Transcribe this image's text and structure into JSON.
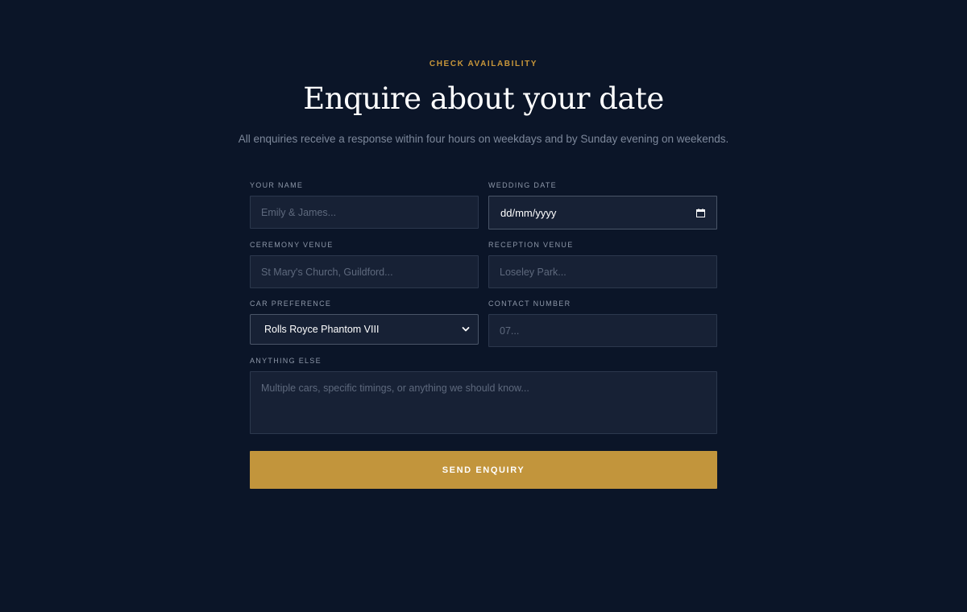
{
  "header": {
    "eyebrow": "CHECK AVAILABILITY",
    "title": "Enquire about your date",
    "subtitle": "All enquiries receive a response within four hours on weekdays and by Sunday evening on weekends."
  },
  "form": {
    "name": {
      "label": "YOUR NAME",
      "placeholder": "Emily & James...",
      "value": ""
    },
    "wedding_date": {
      "label": "WEDDING DATE",
      "value": "dd/mm/yyyy",
      "icon": "calendar-icon"
    },
    "ceremony_venue": {
      "label": "CEREMONY VENUE",
      "placeholder": "St Mary's Church, Guildford...",
      "value": ""
    },
    "reception_venue": {
      "label": "RECEPTION VENUE",
      "placeholder": "Loseley Park...",
      "value": ""
    },
    "car_preference": {
      "label": "CAR PREFERENCE",
      "selected": "Rolls Royce Phantom VIII",
      "icon": "chevron-down-icon"
    },
    "contact_number": {
      "label": "CONTACT NUMBER",
      "placeholder": "07...",
      "value": ""
    },
    "anything_else": {
      "label": "ANYTHING ELSE",
      "placeholder": "Multiple cars, specific timings, or anything we should know...",
      "value": ""
    },
    "submit_label": "SEND ENQUIRY"
  },
  "colors": {
    "background": "#0b1528",
    "accent_gold": "#c2953c",
    "field_bg": "#172135",
    "heading": "#ffffff",
    "muted_text": "#7d889b"
  }
}
